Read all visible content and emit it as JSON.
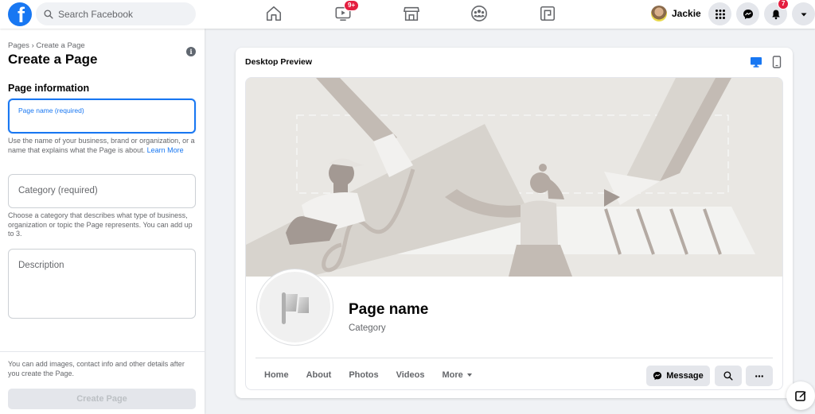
{
  "topbar": {
    "logo": "facebook-logo",
    "logo_glyph": "f",
    "search_placeholder": "Search Facebook",
    "nav": [
      {
        "name": "home",
        "icon": "home-icon",
        "badge": null
      },
      {
        "name": "watch",
        "icon": "video-icon",
        "badge": "9+"
      },
      {
        "name": "marketplace",
        "icon": "marketplace-icon",
        "badge": null
      },
      {
        "name": "groups",
        "icon": "groups-icon",
        "badge": null
      },
      {
        "name": "gaming",
        "icon": "gaming-icon",
        "badge": null
      }
    ],
    "user_name": "Jackie",
    "notifications_badge": "7",
    "right_buttons": [
      "menu-grid-icon",
      "messenger-icon",
      "bell-icon",
      "caret-down-icon"
    ]
  },
  "left_panel": {
    "breadcrumb": "Pages › Create a Page",
    "title": "Create a Page",
    "section_title": "Page information",
    "page_name_field": {
      "label": "Page name (required)",
      "value": ""
    },
    "page_name_help": "Use the name of your business, brand or organization, or a name that explains what the Page is about.",
    "learn_more": "Learn More",
    "category_field": {
      "placeholder": "Category (required)",
      "value": ""
    },
    "category_help": "Choose a category that describes what type of business, organization or topic the Page represents. You can add up to 3.",
    "description_field": {
      "placeholder": "Description",
      "value": ""
    },
    "footer_note": "You can add images, contact info and other details after you create the Page.",
    "create_button": "Create Page"
  },
  "preview": {
    "title": "Desktop Preview",
    "view_modes": [
      {
        "name": "desktop",
        "active": true
      },
      {
        "name": "mobile",
        "active": false
      }
    ],
    "page_name": "Page name",
    "category": "Category",
    "tabs": [
      "Home",
      "About",
      "Photos",
      "Videos",
      "More"
    ],
    "message_button": "Message",
    "colors": {
      "accent": "#1877f2",
      "badge": "#e41e3f",
      "cover_bg": "#e9e7e3"
    }
  }
}
